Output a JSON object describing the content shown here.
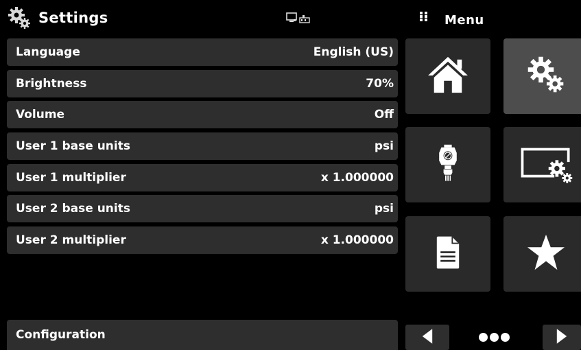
{
  "header": {
    "title": "Settings",
    "icon": "gears-icon",
    "status_icon": "display-network-icon"
  },
  "menu": {
    "label": "Menu",
    "icon": "grip-icon",
    "tiles": [
      {
        "name": "home",
        "icon": "home-icon",
        "active": false
      },
      {
        "name": "settings",
        "icon": "gears-icon",
        "active": true
      },
      {
        "name": "sensor",
        "icon": "transducer-icon",
        "active": false
      },
      {
        "name": "display-settings",
        "icon": "display-gear-icon",
        "active": false
      },
      {
        "name": "documents",
        "icon": "document-icon",
        "active": false
      },
      {
        "name": "favorites",
        "icon": "star-icon",
        "active": false
      }
    ]
  },
  "settings": {
    "rows": [
      {
        "label": "Language",
        "value": "English (US)"
      },
      {
        "label": "Brightness",
        "value": "70%"
      },
      {
        "label": "Volume",
        "value": "Off"
      },
      {
        "label": "User 1 base units",
        "value": "psi"
      },
      {
        "label": "User 1 multiplier",
        "value": "x 1.000000"
      },
      {
        "label": "User 2 base units",
        "value": "psi"
      },
      {
        "label": "User 2 multiplier",
        "value": "x 1.000000"
      }
    ],
    "footer": "Configuration"
  },
  "nav": {
    "prev_icon": "triangle-left-icon",
    "page_indicator": "three-dots-icon",
    "next_icon": "triangle-right-icon"
  },
  "colors": {
    "background": "#000000",
    "row": "#2e2e2e",
    "tile": "#2a2a2a",
    "tile_active": "#4d4d4d",
    "text": "#ffffff"
  }
}
